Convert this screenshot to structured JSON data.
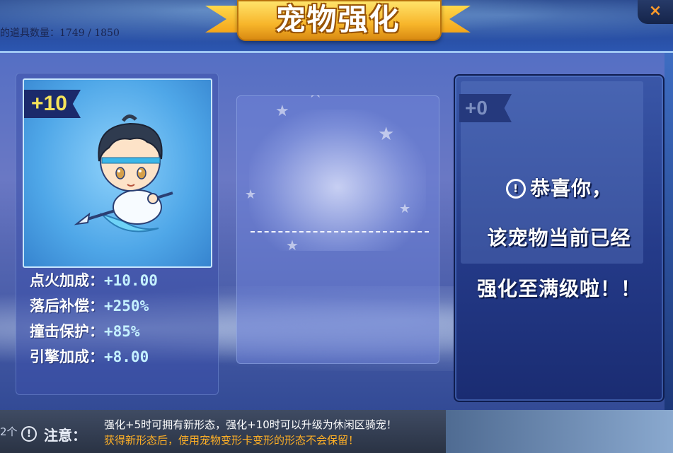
{
  "header": {
    "item_count_label": "的道具数量：1749 / 1850",
    "title": "宠物强化",
    "close_label": "×"
  },
  "left_panel": {
    "level": "+10",
    "stats": [
      {
        "label": "点火加成：",
        "value": "+10.00"
      },
      {
        "label": "落后补偿：",
        "value": "+250%"
      },
      {
        "label": "撞击保护：",
        "value": "+85%"
      },
      {
        "label": "引擎加成：",
        "value": "+8.00"
      }
    ]
  },
  "right_panel": {
    "level": "+0",
    "message_line1": "恭喜你，",
    "message_line2": "该宠物当前已经",
    "message_line3": "强化至满级啦！！",
    "info_icon_glyph": "!"
  },
  "footer": {
    "left_count": "2个",
    "notice_label": "注意：",
    "notice_line1": "强化+5时可拥有新形态，强化+10时可以升级为休闲区骑宠！",
    "notice_line2": "获得新形态后，使用宠物变形卡变形的形态不会保留！",
    "notice_icon_glyph": "!"
  },
  "colors": {
    "level_gold": "#f5e35a",
    "stat_value": "#c5f1ff",
    "notice_orange": "#ffb026",
    "close_orange": "#ff9b2a"
  },
  "icons": {
    "close": "close-icon",
    "info": "info-icon",
    "notice": "warning-icon"
  }
}
